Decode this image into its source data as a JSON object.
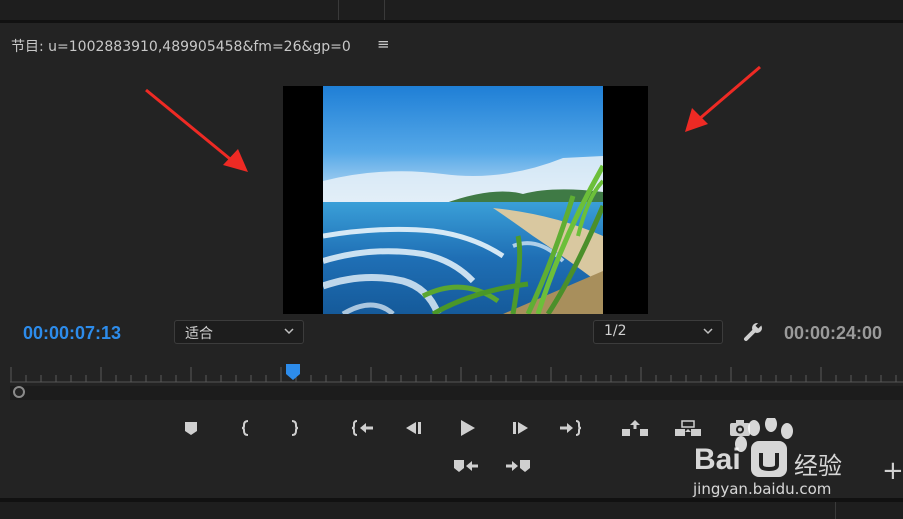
{
  "panel": {
    "title": "节目: u=1002883910,489905458&fm=26&gp=0",
    "menu_icon": "≡"
  },
  "playback": {
    "current_timecode": "00:00:07:13",
    "duration_timecode": "00:00:24:00",
    "current_color": "#2d8ceb"
  },
  "controls": {
    "zoom_select": "适合",
    "resolution_select": "1/2",
    "settings_icon": "wrench-icon"
  },
  "transport": {
    "row1": [
      "add-marker-icon",
      "mark-in-icon",
      "mark-out-icon",
      "go-to-in-icon",
      "step-back-icon",
      "play-icon",
      "step-forward-icon",
      "go-to-out-icon",
      "lift-icon",
      "extract-icon",
      "export-frame-icon"
    ],
    "row2": [
      "insert-icon",
      "overwrite-icon"
    ],
    "add_button": "+"
  },
  "watermark": {
    "brand": "Bai",
    "brand_suffix": "经验",
    "url": "jingyan.baidu.com"
  }
}
